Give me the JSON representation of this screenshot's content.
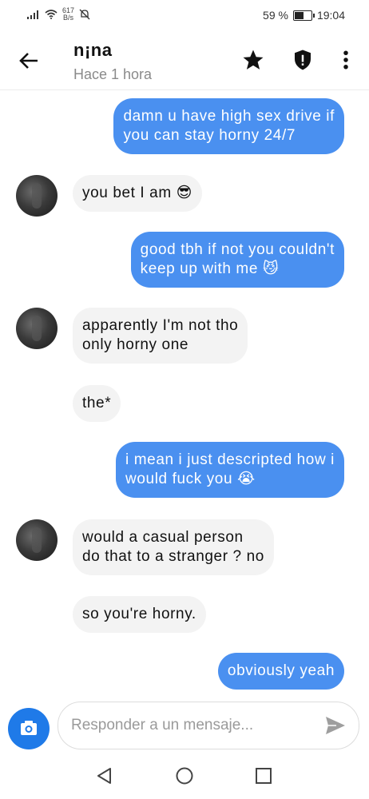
{
  "status_bar": {
    "net_speed_value": "617",
    "net_speed_unit": "B/s",
    "battery_percent": "59 %",
    "battery_level": 0.59,
    "time": "19:04"
  },
  "header": {
    "title": "n¡na",
    "subtitle": "Hace 1 hora"
  },
  "messages": [
    {
      "from": "me",
      "lines": [
        "damn u have high sex drive if",
        "you can stay horny 24/7"
      ]
    },
    {
      "from": "them",
      "lines": [
        "you bet I am 😎"
      ]
    },
    {
      "from": "me",
      "lines": [
        "good tbh if not you couldn't",
        "keep up with me 😼"
      ]
    },
    {
      "from": "them",
      "lines": [
        "apparently I'm not tho",
        "only horny one"
      ]
    },
    {
      "from": "them",
      "lines": [
        "the*"
      ]
    },
    {
      "from": "me",
      "lines": [
        "i mean i just descripted how i",
        "would fuck you 😭"
      ]
    },
    {
      "from": "them",
      "lines": [
        "would a casual person",
        "do that to a stranger ? no"
      ]
    },
    {
      "from": "them",
      "lines": [
        "so you're horny."
      ]
    },
    {
      "from": "me",
      "lines": [
        "obviously yeah"
      ]
    }
  ],
  "composer": {
    "placeholder": "Responder a un mensaje..."
  },
  "colors": {
    "outgoing_bubble": "#4a90f0",
    "incoming_bubble": "#f3f3f3",
    "camera_button": "#1f7ae8"
  }
}
